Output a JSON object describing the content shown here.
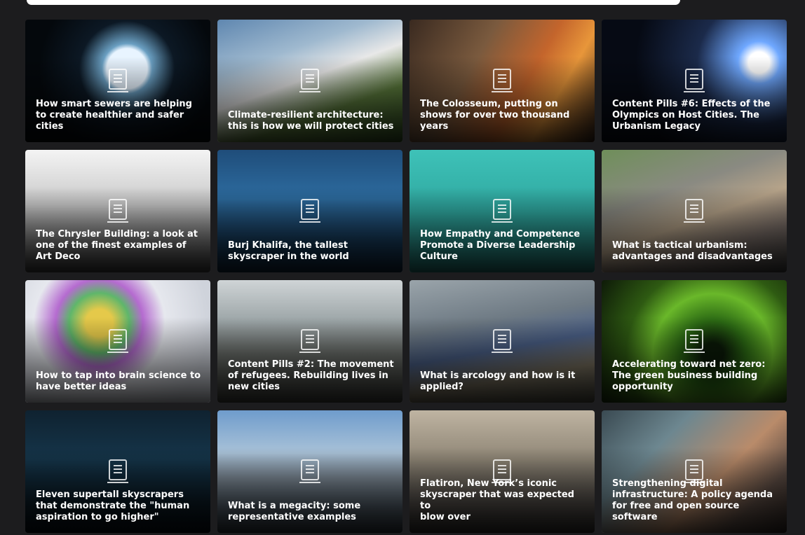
{
  "cards": [
    {
      "lines": [
        "How smart sewers are helping",
        "to create healthier and safer",
        "cities"
      ],
      "bg": "radial-gradient(circle at 55% 40%, #e8f4ff 0 16%, #6a9fc2 20%, #0c1824 38%, #04080c 70%)"
    },
    {
      "lines": [
        "Climate-resilient architecture:",
        "this is how we will protect cities"
      ],
      "bg": "linear-gradient(160deg,#5f87b0 0%,#9fb9cf 30%,#e8e8e8 48%,#5b7a3c 70%,#2d4a1f 100%)"
    },
    {
      "lines": [
        "The Colosseum, putting on",
        "shows for over two thousand",
        "years"
      ],
      "bg": "linear-gradient(120deg,#3a2a20 0%,#7a5a3e 35%,#c4652c 60%,#e8963a 75%,#2a1c14 100%)"
    },
    {
      "lines": [
        "Content Pills #6: Effects of the",
        "Olympics on Host Cities. The",
        "Urbanism Legacy"
      ],
      "bg": "radial-gradient(circle at 85% 35%, #fff 0 6%, #6fa8ff 12%, #1b2a4a 35%, #060a14 70%)"
    },
    {
      "lines": [
        "The Chrysler Building: a look at",
        "one of the finest examples of",
        "Art Deco"
      ],
      "bg": "linear-gradient(180deg,#f4f4f4 0%,#c9c9c9 45%,#6e6e6e 80%,#3a3a3a 100%)"
    },
    {
      "lines": [
        "Burj Khalifa, the tallest",
        "skyscraper in the world"
      ],
      "bg": "linear-gradient(180deg,#1f4d7a 0%,#2d6ca0 40%,#163a5a 75%,#0d2236 100%)"
    },
    {
      "lines": [
        "How Empathy and Competence",
        "Promote a Diverse Leadership",
        "Culture"
      ],
      "bg": "linear-gradient(180deg,#3ec2b8 0%,#2fa8a0 50%,#1e6f6a 100%)"
    },
    {
      "lines": [
        "What is tactical urbanism:",
        "advantages and disadvantages"
      ],
      "bg": "linear-gradient(160deg,#6f8f5a 0%,#8a8a82 35%,#b7a48a 55%,#7a6e68 75%,#3a3a3a 100%)"
    },
    {
      "lines": [
        "How to tap into brain science to",
        "have better ideas"
      ],
      "bg": "radial-gradient(circle at 40% 35%, #e5c94a 0 10%, #5fb66b 22%, #b56bd0 32%, #e6e8ee 48%, #cfd3db 80%)"
    },
    {
      "lines": [
        "Content Pills #2: The movement",
        "of refugees. Rebuilding lives in",
        "new cities"
      ],
      "bg": "linear-gradient(180deg,#cfd4d6 0%,#9aa3a5 35%,#6a6e6a 60%,#3e3f3a 100%)"
    },
    {
      "lines": [
        "What is arcology and how is it",
        "applied?"
      ],
      "bg": "linear-gradient(170deg,#9aa4aa 0%,#6e7a84 35%,#4a5f86 55%,#7a7260 75%,#4a4a40 100%)"
    },
    {
      "lines": [
        "Accelerating toward net zero:",
        "The green business building",
        "opportunity"
      ],
      "bg": "radial-gradient(circle at 60% 60%, #0b1a08 0 8%, #2c6a14 25%, #6ab82a 45%, #2e5a12 65%, #0e1a08 100%)"
    },
    {
      "lines": [
        "Eleven supertall skyscrapers",
        "that demonstrate the \"human",
        "aspiration to go higher\""
      ],
      "bg": "linear-gradient(180deg,#0f2230 0%,#15354a 40%,#0a1a24 75%,#050c12 100%)"
    },
    {
      "lines": [
        "What is a megacity: some",
        "representative examples"
      ],
      "bg": "linear-gradient(180deg,#6f9ccc 0%,#a9c2d8 35%,#7f8c98 55%,#4a5560 80%,#2c333a 100%)"
    },
    {
      "lines": [
        "Flatiron, New York’s iconic",
        "skyscraper that was expected to",
        "blow over"
      ],
      "bg": "linear-gradient(180deg,#bfb4a2 0%,#8f8676 40%,#5b5650 70%,#2e2c2a 100%)"
    },
    {
      "lines": [
        "Strengthening digital",
        "infrastructure: A policy agenda",
        "for free and open source",
        "software"
      ],
      "bg": "linear-gradient(135deg,#3a4a52 0%,#6d8790 30%,#b98b6a 60%,#5a4a42 80%,#2a2320 100%)"
    }
  ]
}
